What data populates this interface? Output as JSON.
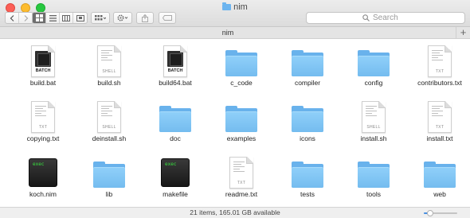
{
  "window": {
    "title": "nim"
  },
  "toolbar": {
    "back_icon": "chevron-left-icon",
    "forward_icon": "chevron-right-icon",
    "view_modes": [
      "icon-view",
      "list-view",
      "column-view",
      "coverflow-view"
    ],
    "active_view": "icon-view",
    "search_placeholder": "Search"
  },
  "pathbar": {
    "title": "nim",
    "add_label": "+"
  },
  "files": [
    {
      "name": "build.bat",
      "kind": "batch",
      "tag": "BATCH"
    },
    {
      "name": "build.sh",
      "kind": "doc",
      "tag": "SHELL"
    },
    {
      "name": "build64.bat",
      "kind": "batch",
      "tag": "BATCH"
    },
    {
      "name": "c_code",
      "kind": "folder"
    },
    {
      "name": "compiler",
      "kind": "folder"
    },
    {
      "name": "config",
      "kind": "folder"
    },
    {
      "name": "contributors.txt",
      "kind": "doc",
      "tag": "TXT"
    },
    {
      "name": "copying.txt",
      "kind": "doc",
      "tag": "TXT"
    },
    {
      "name": "deinstall.sh",
      "kind": "doc",
      "tag": "SHELL"
    },
    {
      "name": "doc",
      "kind": "folder"
    },
    {
      "name": "examples",
      "kind": "folder"
    },
    {
      "name": "icons",
      "kind": "folder"
    },
    {
      "name": "install.sh",
      "kind": "doc",
      "tag": "SHELL"
    },
    {
      "name": "install.txt",
      "kind": "doc",
      "tag": "TXT"
    },
    {
      "name": "koch.nim",
      "kind": "exec",
      "tag": "exec"
    },
    {
      "name": "lib",
      "kind": "folder"
    },
    {
      "name": "makefile",
      "kind": "exec",
      "tag": "exec"
    },
    {
      "name": "readme.txt",
      "kind": "doc",
      "tag": "TXT"
    },
    {
      "name": "tests",
      "kind": "folder"
    },
    {
      "name": "tools",
      "kind": "folder"
    },
    {
      "name": "web",
      "kind": "folder"
    }
  ],
  "status": {
    "text": "21 items, 165.01 GB available",
    "zoom_level": 0.2
  },
  "colors": {
    "folder": "#74bcef",
    "exec_text": "#37e03e",
    "accent": "#4a90e2"
  }
}
